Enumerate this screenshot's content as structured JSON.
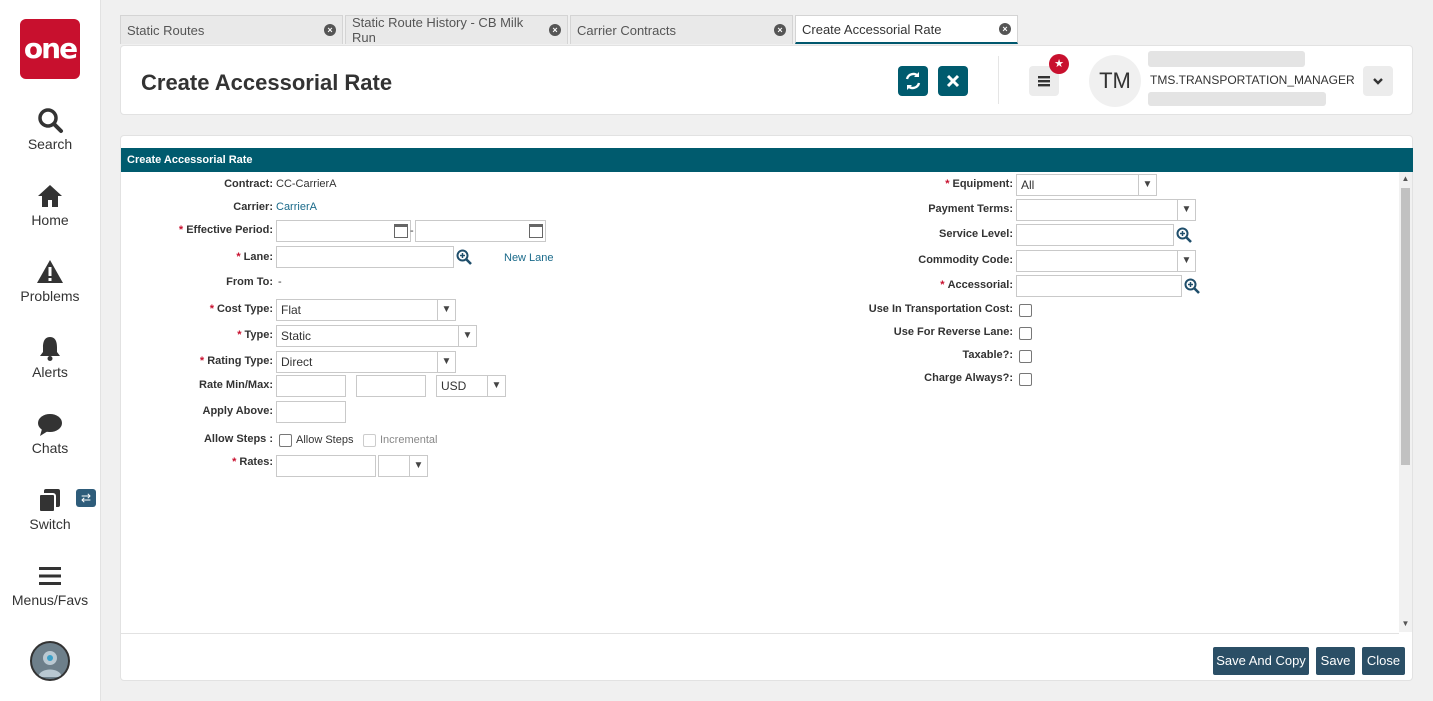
{
  "sidebar": {
    "logo": "one",
    "items": [
      {
        "label": "Search",
        "icon": "search-icon"
      },
      {
        "label": "Home",
        "icon": "home-icon"
      },
      {
        "label": "Problems",
        "icon": "warning-icon"
      },
      {
        "label": "Alerts",
        "icon": "bell-icon"
      },
      {
        "label": "Chats",
        "icon": "chat-icon"
      },
      {
        "label": "Switch",
        "icon": "switch-icon"
      },
      {
        "label": "Menus/Favs",
        "icon": "menu-icon"
      }
    ],
    "switch_badge": "⇄"
  },
  "tabs": [
    {
      "label": "Static Routes",
      "active": false
    },
    {
      "label": "Static Route History - CB Milk Run",
      "active": false
    },
    {
      "label": "Carrier Contracts",
      "active": false
    },
    {
      "label": "Create Accessorial Rate",
      "active": true
    }
  ],
  "header": {
    "title": "Create Accessorial Rate",
    "user_initials": "TM",
    "user_role": "TMS.TRANSPORTATION_MANAGER"
  },
  "panel": {
    "title": "Create Accessorial Rate"
  },
  "form_left": {
    "contract_label": "Contract:",
    "contract_value": "CC-CarrierA",
    "carrier_label": "Carrier:",
    "carrier_value": "CarrierA",
    "effective_period_label": "Effective Period:",
    "effective_sep": "-",
    "lane_label": "Lane:",
    "new_lane_link": "New Lane",
    "from_to_label": "From To:",
    "from_to_value": "-",
    "cost_type_label": "Cost Type:",
    "cost_type_value": "Flat",
    "type_label": "Type:",
    "type_value": "Static",
    "rating_type_label": "Rating Type:",
    "rating_type_value": "Direct",
    "rate_minmax_label": "Rate Min/Max:",
    "currency_value": "USD",
    "apply_above_label": "Apply Above:",
    "allow_steps_label": "Allow Steps :",
    "allow_steps_check": "Allow Steps",
    "incremental_check": "Incremental",
    "rates_label": "Rates:"
  },
  "form_right": {
    "equipment_label": "Equipment:",
    "equipment_value": "All",
    "payment_terms_label": "Payment Terms:",
    "service_level_label": "Service Level:",
    "commodity_code_label": "Commodity Code:",
    "accessorial_label": "Accessorial:",
    "use_transport_cost_label": "Use In Transportation Cost:",
    "use_reverse_lane_label": "Use For Reverse Lane:",
    "taxable_label": "Taxable?:",
    "charge_always_label": "Charge Always?:"
  },
  "footer": {
    "save_and_copy": "Save And Copy",
    "save": "Save",
    "close": "Close"
  },
  "colors": {
    "accent": "#005b6e",
    "brand_red": "#c8102e",
    "footer_button": "#2b4f66"
  }
}
